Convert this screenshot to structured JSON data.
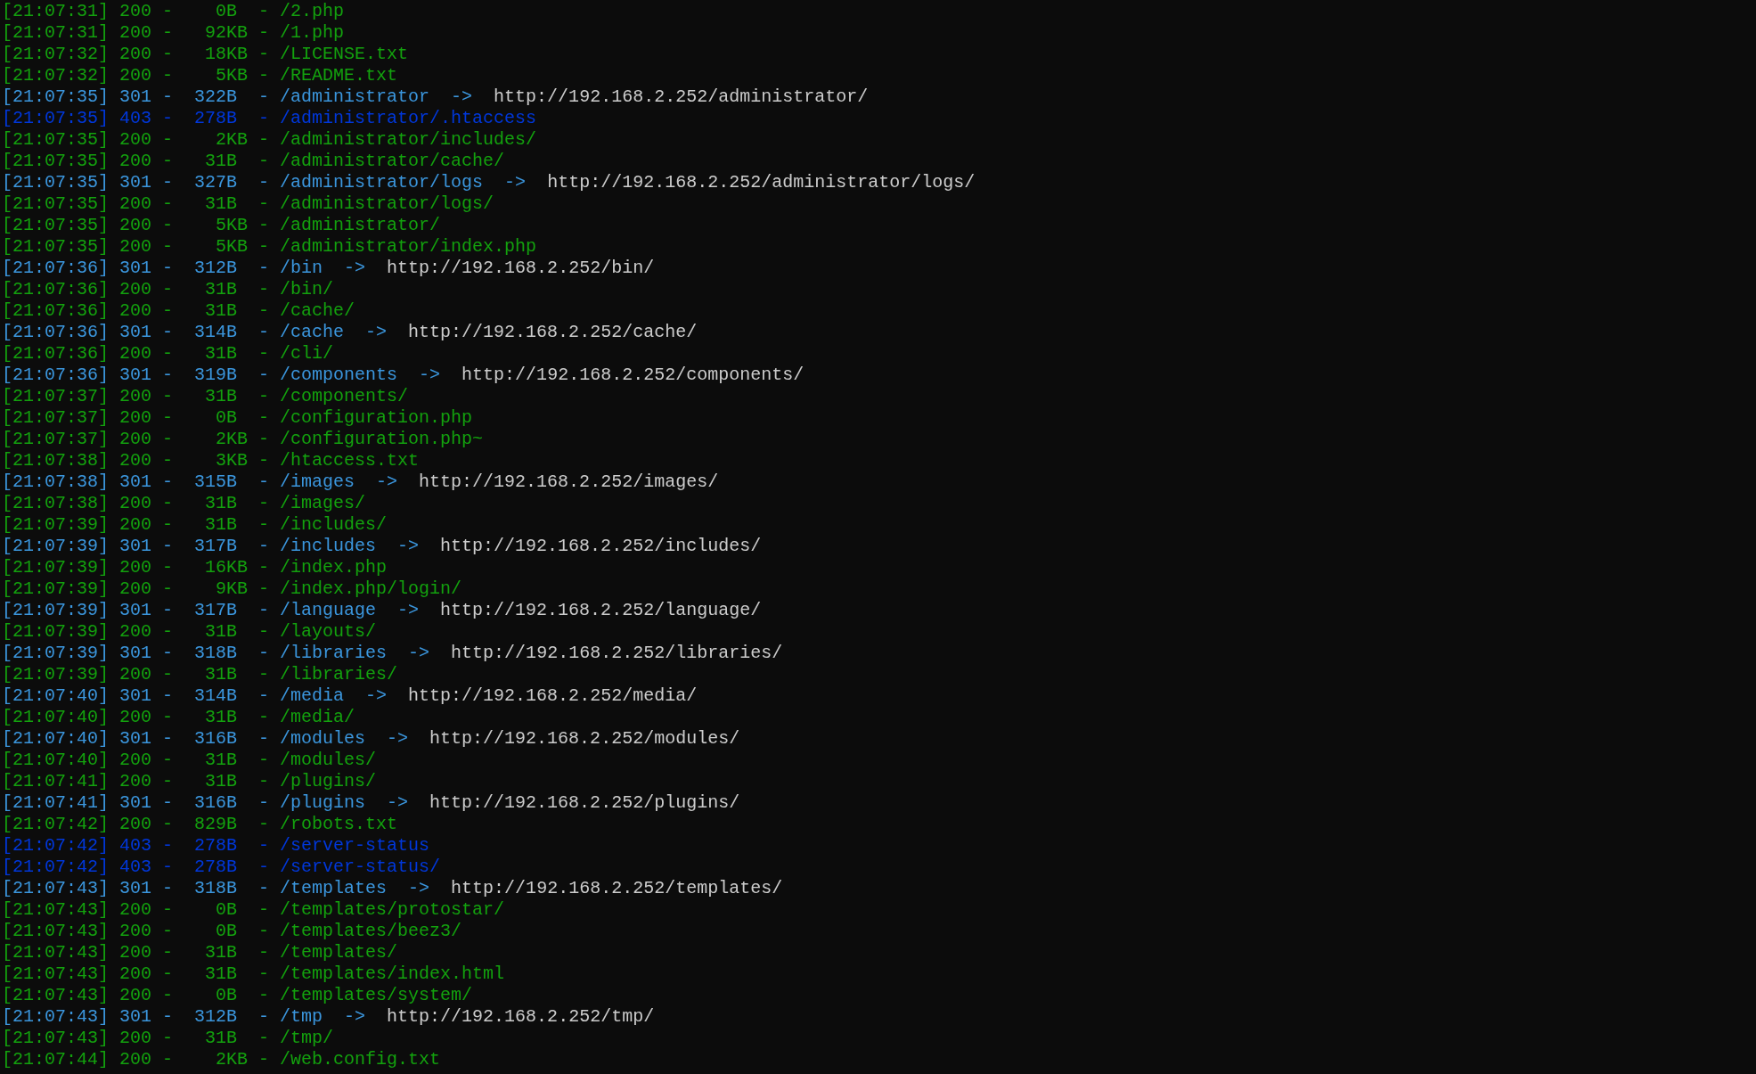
{
  "lines": [
    {
      "kind": "ok",
      "time": "[21:07:31]",
      "text": "200 -    0B  - /2.php"
    },
    {
      "kind": "ok",
      "time": "[21:07:31]",
      "text": "200 -   92KB - /1.php"
    },
    {
      "kind": "ok",
      "time": "[21:07:32]",
      "text": "200 -   18KB - /LICENSE.txt"
    },
    {
      "kind": "ok",
      "time": "[21:07:32]",
      "text": "200 -    5KB - /README.txt"
    },
    {
      "kind": "redirect",
      "time": "[21:07:35]",
      "text": "301 -  322B  - /administrator",
      "arrow": "->",
      "url": "http://192.168.2.252/administrator/"
    },
    {
      "kind": "forbidden",
      "time": "[21:07:35]",
      "text": "403 -  278B  - /administrator/.htaccess"
    },
    {
      "kind": "ok",
      "time": "[21:07:35]",
      "text": "200 -    2KB - /administrator/includes/"
    },
    {
      "kind": "ok",
      "time": "[21:07:35]",
      "text": "200 -   31B  - /administrator/cache/"
    },
    {
      "kind": "redirect",
      "time": "[21:07:35]",
      "text": "301 -  327B  - /administrator/logs",
      "arrow": "->",
      "url": "http://192.168.2.252/administrator/logs/"
    },
    {
      "kind": "ok",
      "time": "[21:07:35]",
      "text": "200 -   31B  - /administrator/logs/"
    },
    {
      "kind": "ok",
      "time": "[21:07:35]",
      "text": "200 -    5KB - /administrator/"
    },
    {
      "kind": "ok",
      "time": "[21:07:35]",
      "text": "200 -    5KB - /administrator/index.php"
    },
    {
      "kind": "redirect",
      "time": "[21:07:36]",
      "text": "301 -  312B  - /bin",
      "arrow": "->",
      "url": "http://192.168.2.252/bin/"
    },
    {
      "kind": "ok",
      "time": "[21:07:36]",
      "text": "200 -   31B  - /bin/"
    },
    {
      "kind": "ok",
      "time": "[21:07:36]",
      "text": "200 -   31B  - /cache/"
    },
    {
      "kind": "redirect",
      "time": "[21:07:36]",
      "text": "301 -  314B  - /cache",
      "arrow": "->",
      "url": "http://192.168.2.252/cache/"
    },
    {
      "kind": "ok",
      "time": "[21:07:36]",
      "text": "200 -   31B  - /cli/"
    },
    {
      "kind": "redirect",
      "time": "[21:07:36]",
      "text": "301 -  319B  - /components",
      "arrow": "->",
      "url": "http://192.168.2.252/components/"
    },
    {
      "kind": "ok",
      "time": "[21:07:37]",
      "text": "200 -   31B  - /components/"
    },
    {
      "kind": "ok",
      "time": "[21:07:37]",
      "text": "200 -    0B  - /configuration.php"
    },
    {
      "kind": "ok",
      "time": "[21:07:37]",
      "text": "200 -    2KB - /configuration.php~"
    },
    {
      "kind": "ok",
      "time": "[21:07:38]",
      "text": "200 -    3KB - /htaccess.txt"
    },
    {
      "kind": "redirect",
      "time": "[21:07:38]",
      "text": "301 -  315B  - /images",
      "arrow": "->",
      "url": "http://192.168.2.252/images/"
    },
    {
      "kind": "ok",
      "time": "[21:07:38]",
      "text": "200 -   31B  - /images/"
    },
    {
      "kind": "ok",
      "time": "[21:07:39]",
      "text": "200 -   31B  - /includes/"
    },
    {
      "kind": "redirect",
      "time": "[21:07:39]",
      "text": "301 -  317B  - /includes",
      "arrow": "->",
      "url": "http://192.168.2.252/includes/"
    },
    {
      "kind": "ok",
      "time": "[21:07:39]",
      "text": "200 -   16KB - /index.php"
    },
    {
      "kind": "ok",
      "time": "[21:07:39]",
      "text": "200 -    9KB - /index.php/login/"
    },
    {
      "kind": "redirect",
      "time": "[21:07:39]",
      "text": "301 -  317B  - /language",
      "arrow": "->",
      "url": "http://192.168.2.252/language/"
    },
    {
      "kind": "ok",
      "time": "[21:07:39]",
      "text": "200 -   31B  - /layouts/"
    },
    {
      "kind": "redirect",
      "time": "[21:07:39]",
      "text": "301 -  318B  - /libraries",
      "arrow": "->",
      "url": "http://192.168.2.252/libraries/"
    },
    {
      "kind": "ok",
      "time": "[21:07:39]",
      "text": "200 -   31B  - /libraries/"
    },
    {
      "kind": "redirect",
      "time": "[21:07:40]",
      "text": "301 -  314B  - /media",
      "arrow": "->",
      "url": "http://192.168.2.252/media/"
    },
    {
      "kind": "ok",
      "time": "[21:07:40]",
      "text": "200 -   31B  - /media/"
    },
    {
      "kind": "redirect",
      "time": "[21:07:40]",
      "text": "301 -  316B  - /modules",
      "arrow": "->",
      "url": "http://192.168.2.252/modules/"
    },
    {
      "kind": "ok",
      "time": "[21:07:40]",
      "text": "200 -   31B  - /modules/"
    },
    {
      "kind": "ok",
      "time": "[21:07:41]",
      "text": "200 -   31B  - /plugins/"
    },
    {
      "kind": "redirect",
      "time": "[21:07:41]",
      "text": "301 -  316B  - /plugins",
      "arrow": "->",
      "url": "http://192.168.2.252/plugins/"
    },
    {
      "kind": "ok",
      "time": "[21:07:42]",
      "text": "200 -  829B  - /robots.txt"
    },
    {
      "kind": "forbidden",
      "time": "[21:07:42]",
      "text": "403 -  278B  - /server-status"
    },
    {
      "kind": "forbidden",
      "time": "[21:07:42]",
      "text": "403 -  278B  - /server-status/"
    },
    {
      "kind": "redirect",
      "time": "[21:07:43]",
      "text": "301 -  318B  - /templates",
      "arrow": "->",
      "url": "http://192.168.2.252/templates/"
    },
    {
      "kind": "ok",
      "time": "[21:07:43]",
      "text": "200 -    0B  - /templates/protostar/"
    },
    {
      "kind": "ok",
      "time": "[21:07:43]",
      "text": "200 -    0B  - /templates/beez3/"
    },
    {
      "kind": "ok",
      "time": "[21:07:43]",
      "text": "200 -   31B  - /templates/"
    },
    {
      "kind": "ok",
      "time": "[21:07:43]",
      "text": "200 -   31B  - /templates/index.html"
    },
    {
      "kind": "ok",
      "time": "[21:07:43]",
      "text": "200 -    0B  - /templates/system/"
    },
    {
      "kind": "redirect",
      "time": "[21:07:43]",
      "text": "301 -  312B  - /tmp",
      "arrow": "->",
      "url": "http://192.168.2.252/tmp/"
    },
    {
      "kind": "ok",
      "time": "[21:07:43]",
      "text": "200 -   31B  - /tmp/"
    },
    {
      "kind": "ok",
      "time": "[21:07:44]",
      "text": "200 -    2KB - /web.config.txt"
    }
  ]
}
